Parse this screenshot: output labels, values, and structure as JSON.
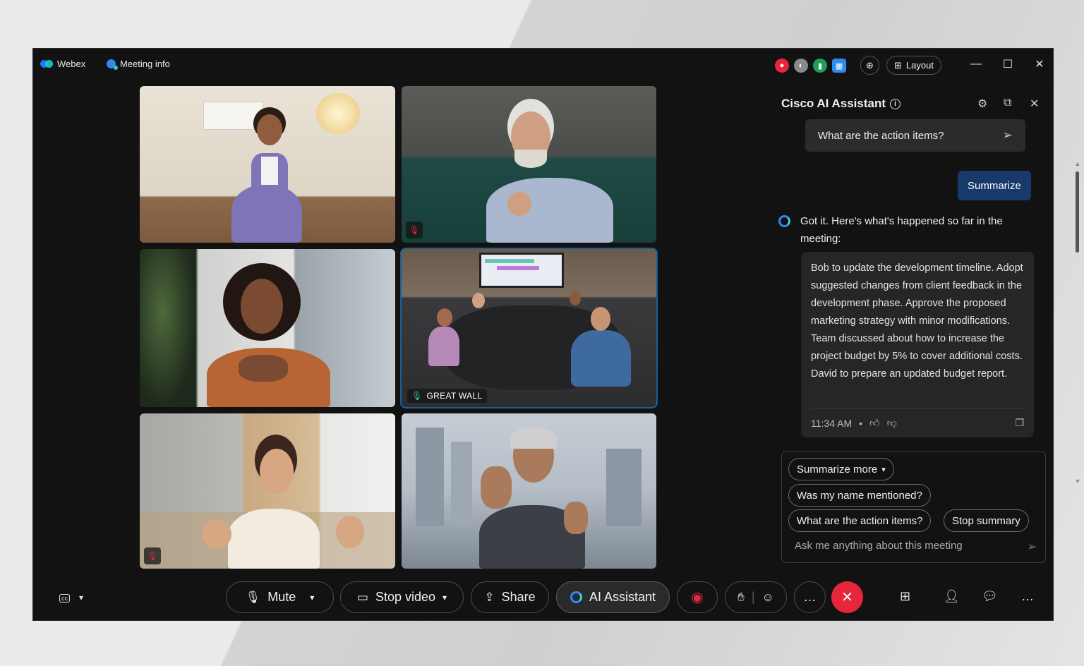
{
  "titlebar": {
    "app_name": "Webex",
    "meeting_info": "Meeting info",
    "layout_label": "Layout",
    "status_icons": [
      {
        "name": "recording-status-icon",
        "color": "#e5263b"
      },
      {
        "name": "noise-removal-icon",
        "color": "#8a8a8a"
      },
      {
        "name": "network-health-icon",
        "color": "#1e9e57"
      },
      {
        "name": "apps-icon",
        "color": "#2d8bf0"
      }
    ]
  },
  "tiles": [
    {
      "name": "participant-tile-1",
      "muted": false,
      "label": ""
    },
    {
      "name": "participant-tile-2",
      "muted": true,
      "label": ""
    },
    {
      "name": "participant-tile-3",
      "muted": false,
      "label": ""
    },
    {
      "name": "participant-tile-4",
      "muted": false,
      "label": "GREAT WALL",
      "active_speaker": true
    },
    {
      "name": "participant-tile-5",
      "muted": true,
      "label": ""
    },
    {
      "name": "participant-tile-6",
      "muted": false,
      "label": ""
    }
  ],
  "ai_panel": {
    "title": "Cisco AI Assistant",
    "user_query": "What are the action items?",
    "summarize_label": "Summarize",
    "response_intro": "Got it. Here's what's happened so far in the meeting:",
    "response_body": "Bob to update the development timeline. Adopt suggested changes from client feedback in the development phase. Approve the proposed marketing strategy with minor modifications. Team discussed about how to increase the project budget by 5% to cover additional costs. David to prepare an updated budget report.",
    "timestamp": "11:34 AM",
    "suggestions": {
      "summarize_more": "Summarize more",
      "name_mentioned": "Was my name mentioned?",
      "action_items": "What are the action items?",
      "stop_summary": "Stop summary"
    },
    "ask_placeholder": "Ask me anything about this meeting"
  },
  "toolbar": {
    "mute_label": "Mute",
    "stop_video_label": "Stop video",
    "share_label": "Share",
    "ai_assistant_label": "AI Assistant",
    "end_call_color": "#e5263b"
  }
}
